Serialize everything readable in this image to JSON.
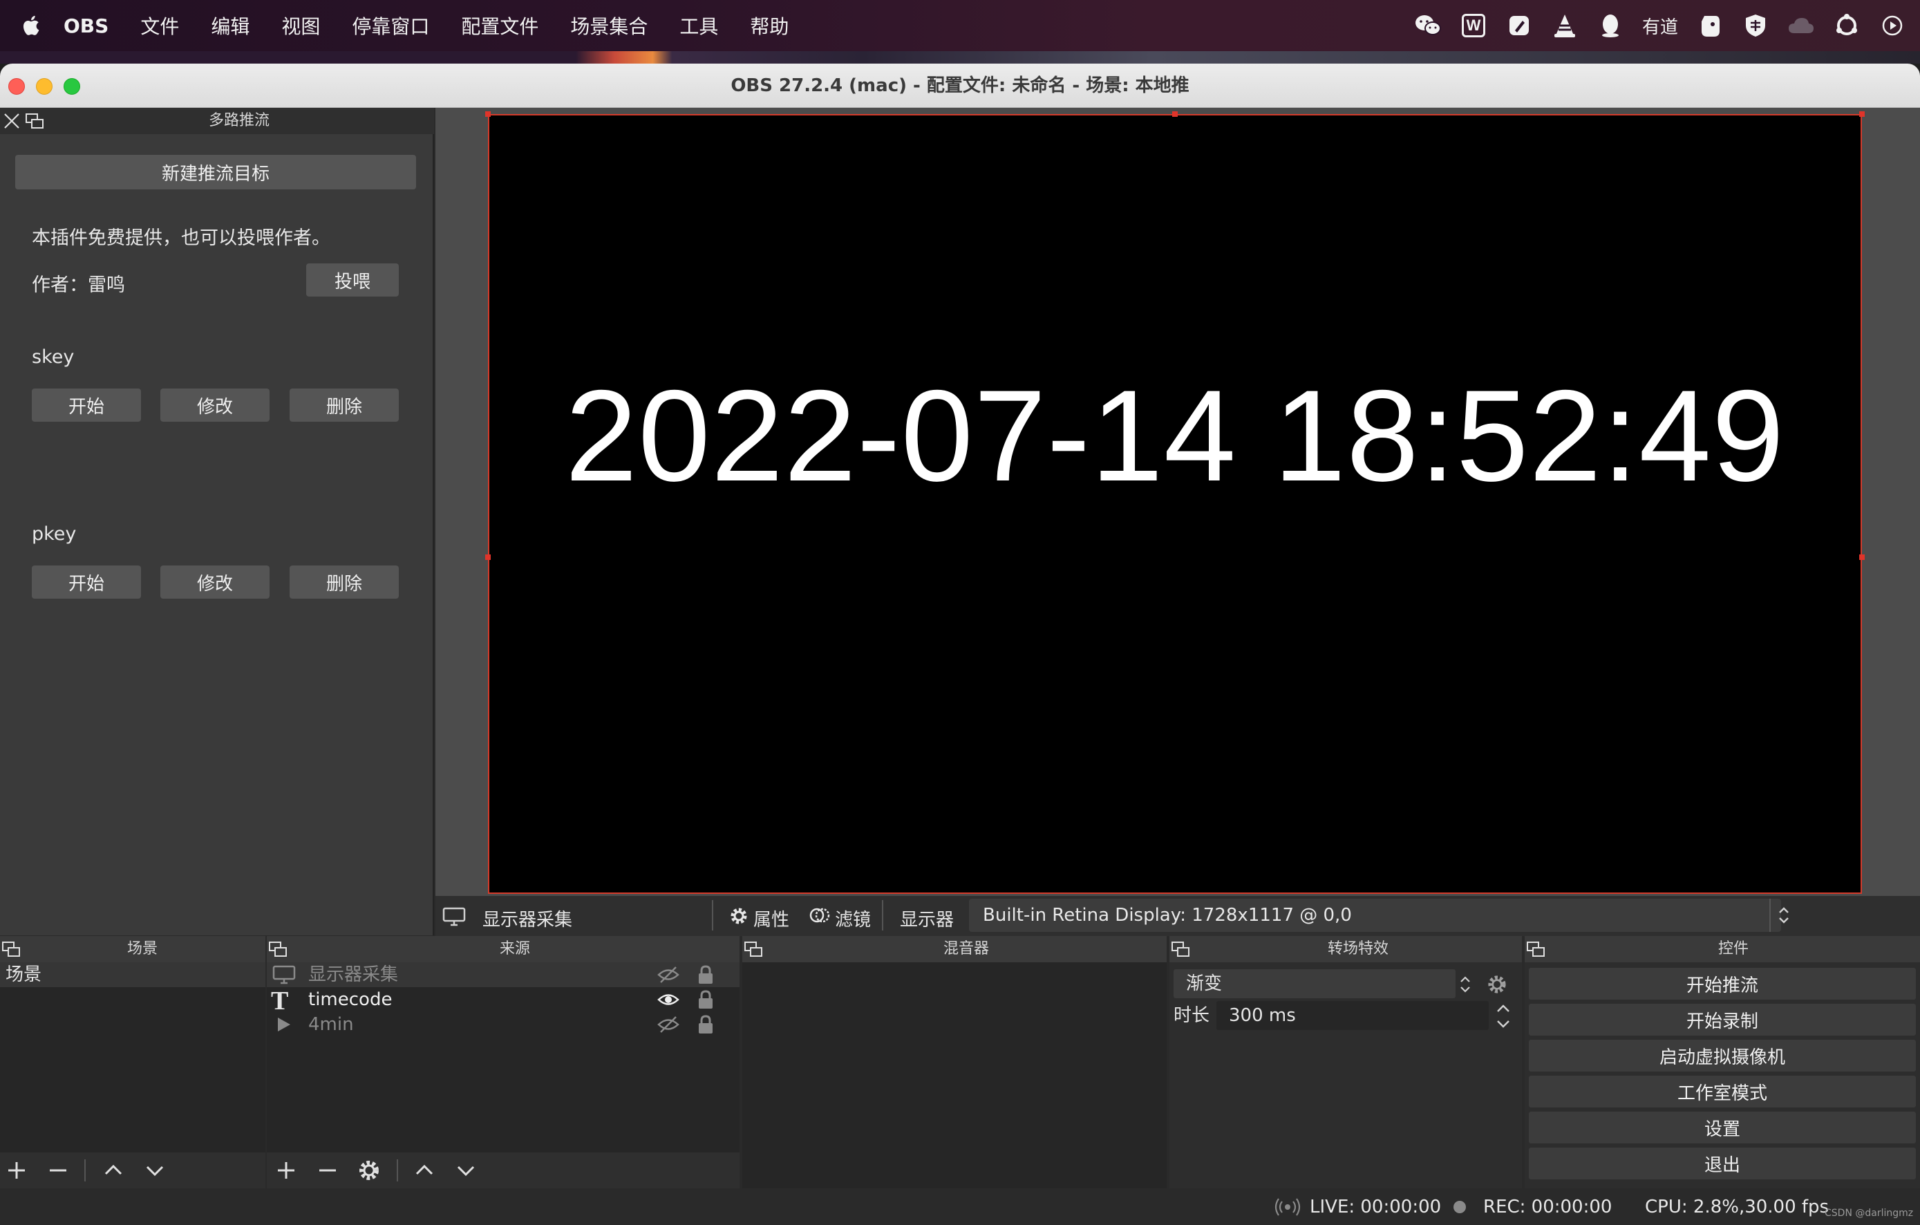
{
  "menubar": {
    "app": "OBS",
    "items": [
      "文件",
      "编辑",
      "视图",
      "停靠窗口",
      "配置文件",
      "场景集合",
      "工具",
      "帮助"
    ],
    "tray": {
      "wechat": "wechat-icon",
      "wps": "W",
      "pen": "pen-icon",
      "vlc": "vlc-icon",
      "qq": "qq-icon",
      "youdao": "有道",
      "evernote": "evernote-icon",
      "vpn": "shield-icon",
      "cloud": "cloud-icon",
      "hub": "hub-icon",
      "play": "play-circle-icon"
    }
  },
  "window": {
    "title": "OBS 27.2.4 (mac) - 配置文件: 未命名 - 场景: 本地推"
  },
  "multi_push": {
    "title": "多路推流",
    "new_target": "新建推流目标",
    "notice": "本插件免费提供，也可以投喂作者。",
    "author_label": "作者：雷鸣",
    "donate": "投喂",
    "targets": [
      {
        "name": "skey",
        "start": "开始",
        "edit": "修改",
        "delete": "删除"
      },
      {
        "name": "pkey",
        "start": "开始",
        "edit": "修改",
        "delete": "删除"
      }
    ]
  },
  "preview": {
    "clock": "2022-07-14 18:52:49"
  },
  "source_toolbar": {
    "source_name": "显示器采集",
    "properties": "属性",
    "filters": "滤镜",
    "display_label": "显示器",
    "display_value": "Built-in Retina Display: 1728x1117 @ 0,0"
  },
  "docks": {
    "scenes": {
      "title": "场景",
      "items": [
        "场景"
      ]
    },
    "sources": {
      "title": "来源",
      "items": [
        {
          "name": "显示器采集",
          "visible": false,
          "locked": true
        },
        {
          "name": "timecode",
          "visible": true,
          "locked": true
        },
        {
          "name": "4min",
          "visible": false,
          "locked": true
        }
      ]
    },
    "mixer": {
      "title": "混音器"
    },
    "transitions": {
      "title": "转场特效",
      "selected": "渐变",
      "duration_label": "时长",
      "duration_value": "300 ms"
    },
    "controls": {
      "title": "控件",
      "buttons": [
        "开始推流",
        "开始录制",
        "启动虚拟摄像机",
        "工作室模式",
        "设置",
        "退出"
      ]
    }
  },
  "status": {
    "live": "LIVE: 00:00:00",
    "rec": "REC: 00:00:00",
    "cpu": "CPU: 2.8%,30.00 fps",
    "watermark": "CSDN @darlingmz"
  },
  "colors": {
    "accent_red": "#e0342a",
    "close": "#fe5f57",
    "minimize": "#febc2e",
    "maximize": "#28c840"
  }
}
